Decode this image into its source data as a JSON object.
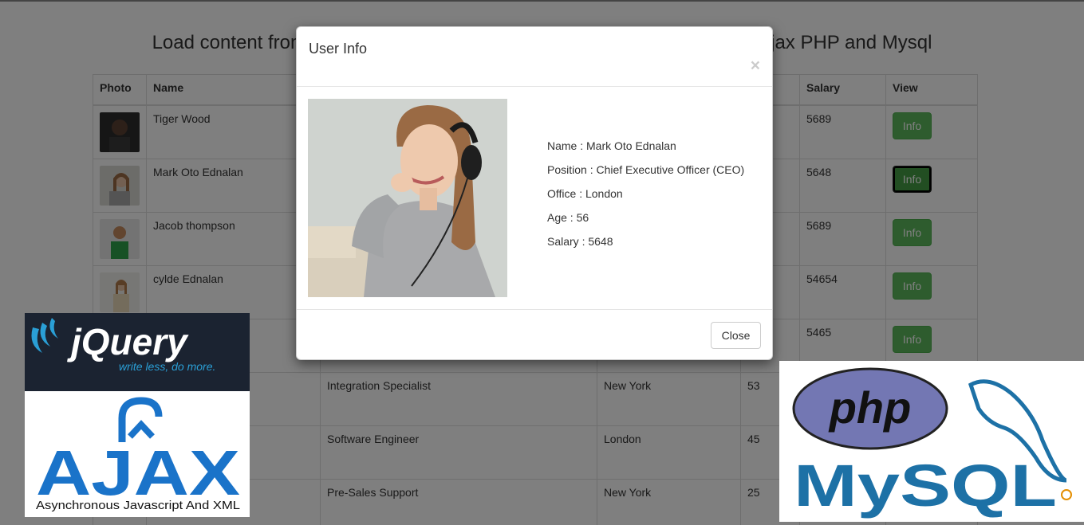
{
  "page": {
    "title": "Load content from MySQL database into Bootstrap Modal using Jquery Ajax PHP and Mysql"
  },
  "table": {
    "headers": {
      "photo": "Photo",
      "name": "Name",
      "salary": "Salary",
      "view": "View"
    },
    "rows": [
      {
        "name": "Tiger Wood",
        "position": "",
        "office": "",
        "age": "",
        "salary": "5689",
        "view": "Info"
      },
      {
        "name": "Mark Oto Ednalan",
        "position": "",
        "office": "",
        "age": "",
        "salary": "5648",
        "view": "Info"
      },
      {
        "name": "Jacob thompson",
        "position": "",
        "office": "",
        "age": "",
        "salary": "5689",
        "view": "Info"
      },
      {
        "name": "cylde Ednalan",
        "position": "",
        "office": "",
        "age": "",
        "salary": "54654",
        "view": "Info"
      },
      {
        "name": "",
        "position": "",
        "office": "",
        "age": "",
        "salary": "5465",
        "view": "Info"
      },
      {
        "name": "",
        "position": "Integration Specialist",
        "office": "New York",
        "age": "53",
        "salary": "",
        "view": ""
      },
      {
        "name": "",
        "position": "Software Engineer",
        "office": "London",
        "age": "45",
        "salary": "",
        "view": ""
      },
      {
        "name": "",
        "position": "Pre-Sales Support",
        "office": "New York",
        "age": "25",
        "salary": "",
        "view": ""
      }
    ]
  },
  "modal": {
    "title": "User Info",
    "close_x": "×",
    "name_line": "Name : Mark Oto Ednalan",
    "position_line": "Position : Chief Executive Officer (CEO)",
    "office_line": "Office : London",
    "age_line": "Age : 56",
    "salary_line": "Salary : 5648",
    "close_button": "Close"
  },
  "logos": {
    "jquery": {
      "wordmark": "jQuery",
      "tagline": "write less, do more."
    },
    "ajax": {
      "wordmark": "AJAX",
      "tagline": "Asynchronous Javascript And XML"
    },
    "php": {
      "wordmark": "php"
    },
    "mysql": {
      "wordmark": "MySQL"
    }
  },
  "colors": {
    "button_green": "#5cb85c",
    "jquery_bg": "#1b2331",
    "php_oval": "#7377b3",
    "mysql_blue": "#1d71a6",
    "mysql_orange": "#e48e00"
  }
}
